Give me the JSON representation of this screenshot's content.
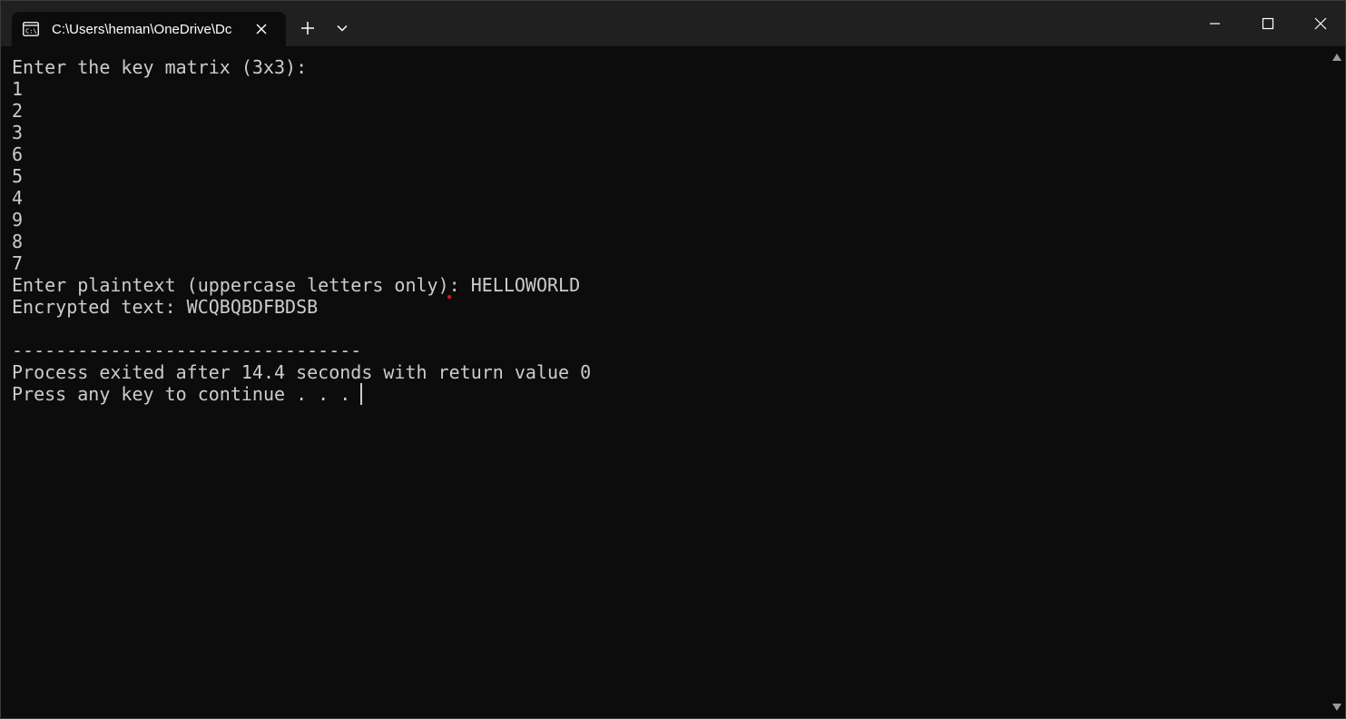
{
  "tab": {
    "title": "C:\\Users\\heman\\OneDrive\\Dc",
    "icon": "terminal-icon",
    "close_icon": "close-icon"
  },
  "toolbar": {
    "new_tab_icon": "plus-icon",
    "dropdown_icon": "chevron-down-icon"
  },
  "window_controls": {
    "minimize_icon": "minimize-icon",
    "maximize_icon": "maximize-icon",
    "close_icon": "close-icon"
  },
  "console": {
    "lines": [
      "Enter the key matrix (3x3):",
      "1",
      "2",
      "3",
      "6",
      "5",
      "4",
      "9",
      "8",
      "7",
      "Enter plaintext (uppercase letters only): HELLOWORLD",
      "Encrypted text: WCQBQBDFBDSB",
      "",
      "--------------------------------",
      "Process exited after 14.4 seconds with return value 0",
      "Press any key to continue . . . "
    ]
  },
  "colors": {
    "background": "#0c0c0c",
    "titlebar": "#202020",
    "text": "#cccccc"
  }
}
